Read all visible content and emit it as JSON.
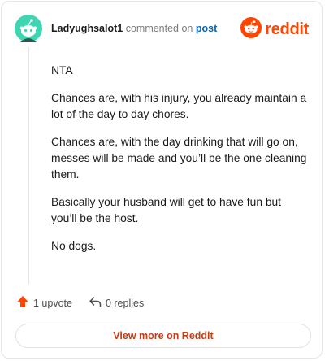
{
  "comment": {
    "username": "Ladyughsalot1",
    "commented_on_text": "commented on",
    "post_link_text": "post",
    "paragraphs": [
      "NTA",
      "Chances are, with his injury, you already maintain a lot of the day to day chores.",
      "Chances are, with the day drinking that will go on, messes will be made and you’ll be the one cleaning them.",
      "Basically your husband will get to have fun but you’ll be the host.",
      "No dogs."
    ]
  },
  "brand": {
    "name": "reddit",
    "icon": "reddit-logo-icon",
    "color": "#ff4500"
  },
  "avatar": {
    "icon": "snoo-avatar-icon",
    "color": "#3ed6b1"
  },
  "actions": {
    "upvote_label": "1 upvote",
    "upvote_icon": "upvote-arrow-icon",
    "upvote_color": "#ff4500",
    "replies_label": "0 replies",
    "reply_icon": "reply-arrow-icon"
  },
  "footer": {
    "view_more_label": "View more on Reddit"
  }
}
